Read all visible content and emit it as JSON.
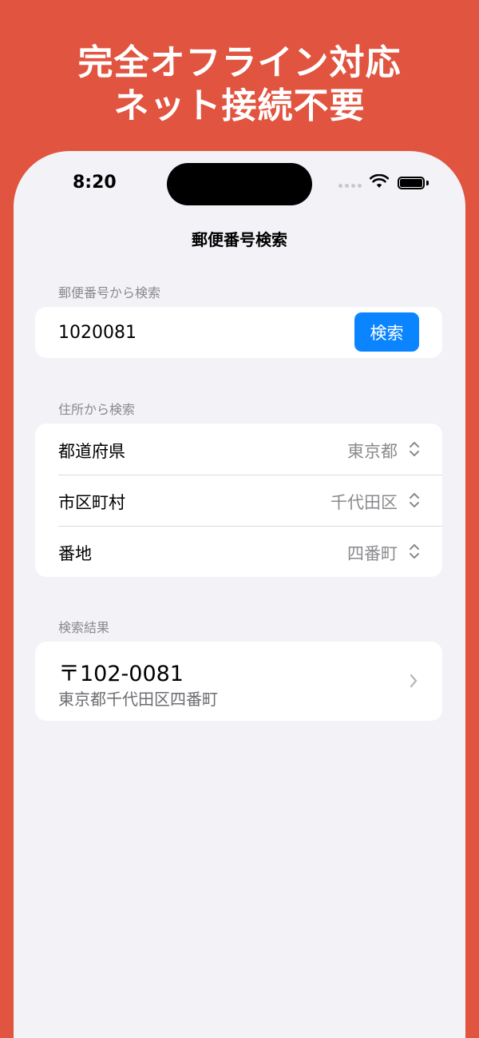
{
  "promo": {
    "line1": "完全オフライン対応",
    "line2": "ネット接続不要"
  },
  "status_bar": {
    "time": "8:20"
  },
  "nav": {
    "title": "郵便番号検索"
  },
  "zip_search": {
    "header": "郵便番号から検索",
    "input_value": "1020081",
    "button_label": "検索"
  },
  "address_search": {
    "header": "住所から検索",
    "rows": [
      {
        "label": "都道府県",
        "value": "東京都"
      },
      {
        "label": "市区町村",
        "value": "千代田区"
      },
      {
        "label": "番地",
        "value": "四番町"
      }
    ]
  },
  "results": {
    "header": "検索結果",
    "items": [
      {
        "zip": "〒102-0081",
        "address": "東京都千代田区四番町"
      }
    ]
  },
  "colors": {
    "background": "#E15440",
    "accent": "#0A84FF",
    "screen": "#F2F2F7"
  }
}
